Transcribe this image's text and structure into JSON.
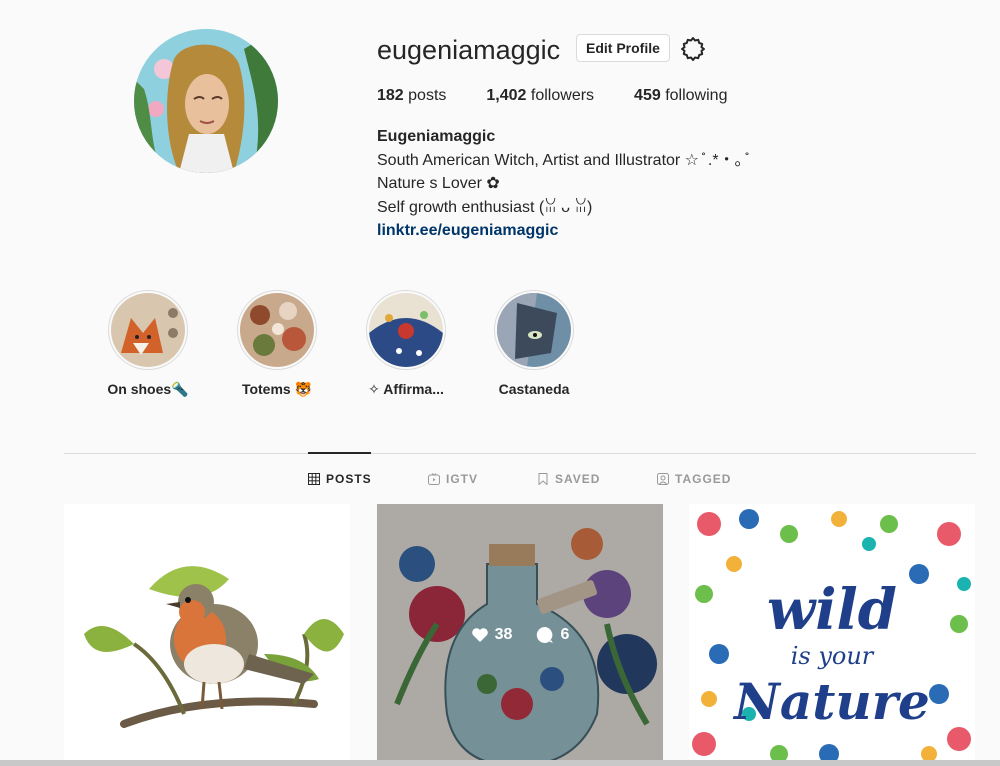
{
  "profile": {
    "username": "eugeniamaggic",
    "edit_label": "Edit Profile",
    "settings_icon": "gear-icon",
    "stats": {
      "posts_count": "182",
      "posts_label": "posts",
      "followers_count": "1,402",
      "followers_label": "followers",
      "following_count": "459",
      "following_label": "following"
    },
    "bio": {
      "name": "Eugeniamaggic",
      "line1": "South American Witch, Artist and Illustrator ☆ ̊ .*・｡ ̊",
      "line2": "Nature s Lover ✿",
      "line3": "Self growth enthusiast (ꈍ ᴗ ꈍ)",
      "link": "linktr.ee/eugeniamaggic"
    }
  },
  "highlights": [
    {
      "label": "On shoes🔦"
    },
    {
      "label": "Totems 🐯"
    },
    {
      "label": "✧ Affirma..."
    },
    {
      "label": "Castaneda"
    }
  ],
  "tabs": [
    {
      "label": "POSTS",
      "icon": "grid-icon",
      "active": true
    },
    {
      "label": "IGTV",
      "icon": "igtv-icon",
      "active": false
    },
    {
      "label": "SAVED",
      "icon": "bookmark-icon",
      "active": false
    },
    {
      "label": "TAGGED",
      "icon": "tagged-icon",
      "active": false
    }
  ],
  "posts": [
    {
      "subject": "robin-on-ginkgo-branch"
    },
    {
      "subject": "floral-bottle-watercolor",
      "likes": "38",
      "comments": "6"
    },
    {
      "subject": "wild-is-your-nature-lettering",
      "text_line1": "wild",
      "text_line2": "is your",
      "text_line3": "Nature"
    }
  ],
  "colors": {
    "background": "#fafafa",
    "text": "#262626",
    "link": "#003569",
    "border": "#dbdbdb",
    "muted": "#999999"
  }
}
